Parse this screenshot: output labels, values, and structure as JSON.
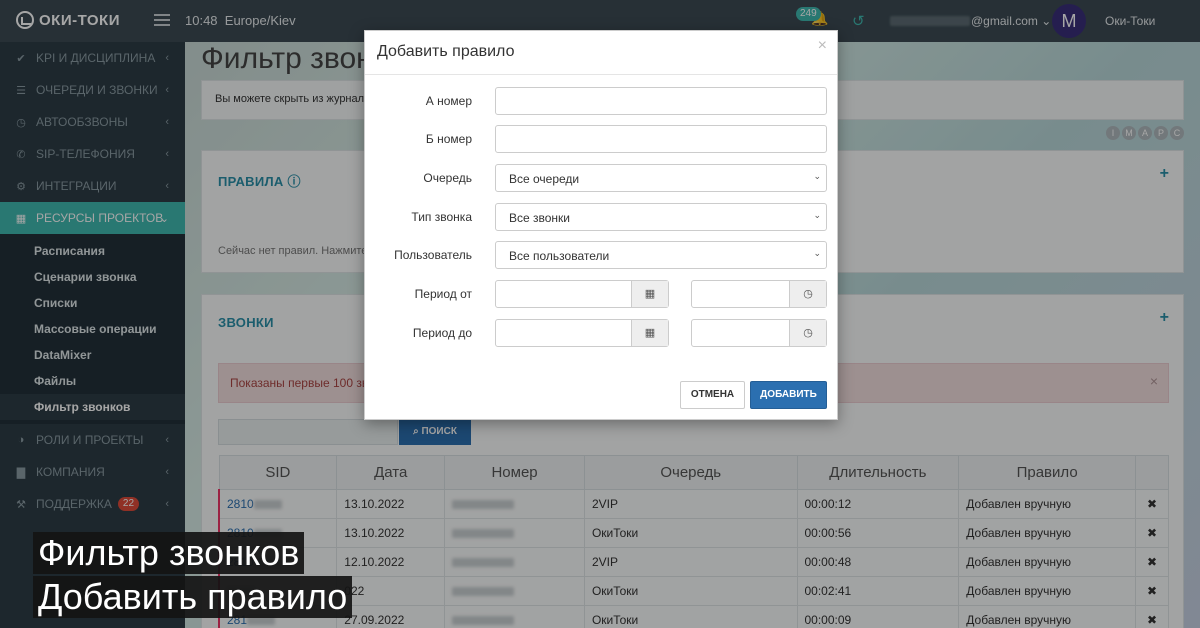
{
  "topbar": {
    "logo": "ОКИ-ТОКИ",
    "time": "10:48",
    "timezone": "Europe/Kiev",
    "notifications": "249",
    "email_suffix": "@gmail.com",
    "avatar_letter": "M",
    "user_name": "Оки-Токи"
  },
  "sidebar": {
    "items": [
      {
        "label": "KPI и дисциплина",
        "icon": "check-icon"
      },
      {
        "label": "Очереди и звонки",
        "icon": "list-icon"
      },
      {
        "label": "Автообзвоны",
        "icon": "clock-icon"
      },
      {
        "label": "SIP-телефония",
        "icon": "phone-icon"
      },
      {
        "label": "Интеграции",
        "icon": "cogs-icon"
      },
      {
        "label": "Ресурсы проектов",
        "icon": "grid-icon"
      },
      {
        "label": "Роли и проекты",
        "icon": "toggle-icon"
      },
      {
        "label": "Компания",
        "icon": "chart-icon"
      },
      {
        "label": "Поддержка",
        "icon": "wrench-icon",
        "badge": "22"
      }
    ],
    "submenu": [
      "Расписания",
      "Сценарии звонка",
      "Списки",
      "Массовые операции",
      "DataMixer",
      "Файлы",
      "Фильтр звонков"
    ]
  },
  "main": {
    "title": "Фильтр звонков",
    "info": "Вы можете скрыть из журнала",
    "imapc": [
      "I",
      "M",
      "A",
      "P",
      "C"
    ],
    "rules_title": "ПРАВИЛА",
    "rules_empty": "Сейчас нет правил. Нажмите",
    "calls_title": "ЗВОНКИ",
    "alert": "Показаны первые 100 зв",
    "search_button": "ПОИСК",
    "columns": [
      "SID",
      "Дата",
      "Номер",
      "Очередь",
      "Длительность",
      "Правило"
    ],
    "rows": [
      {
        "sid": "2810",
        "date": "13.10.2022",
        "queue": "2VIP",
        "duration": "00:00:12",
        "rule": "Добавлен вручную"
      },
      {
        "sid": "2810",
        "date": "13.10.2022",
        "queue": "ОкиТоки",
        "duration": "00:00:56",
        "rule": "Добавлен вручную"
      },
      {
        "sid": "2810",
        "date": "12.10.2022",
        "queue": "2VIP",
        "duration": "00:00:48",
        "rule": "Добавлен вручную"
      },
      {
        "sid": "",
        "date": "022",
        "queue": "ОкиТоки",
        "duration": "00:02:41",
        "rule": "Добавлен вручную"
      },
      {
        "sid": "281",
        "date": "27.09.2022",
        "queue": "ОкиТоки",
        "duration": "00:00:09",
        "rule": "Добавлен вручную"
      }
    ]
  },
  "modal": {
    "title": "Добавить правило",
    "labels": {
      "a_number": "А номер",
      "b_number": "Б номер",
      "queue": "Очередь",
      "call_type": "Тип звонка",
      "user": "Пользователь",
      "period_from": "Период от",
      "period_to": "Период до"
    },
    "selects": {
      "queue": "Все очереди",
      "call_type": "Все звонки",
      "user": "Все пользователи"
    },
    "cancel": "ОТМЕНА",
    "add": "ДОБАВИТЬ"
  },
  "caption": {
    "line1": "Фильтр звонков",
    "line2": "Добавить правило"
  }
}
